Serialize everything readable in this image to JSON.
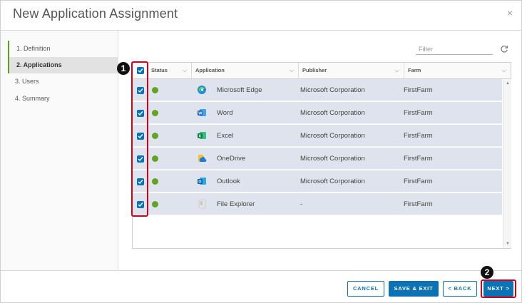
{
  "dialog": {
    "title": "New Application Assignment",
    "close": "×"
  },
  "sidebar": {
    "steps": [
      {
        "label": "1. Definition",
        "state": "done"
      },
      {
        "label": "2. Applications",
        "state": "active"
      },
      {
        "label": "3. Users",
        "state": "pending"
      },
      {
        "label": "4. Summary",
        "state": "pending"
      }
    ]
  },
  "filter": {
    "placeholder": "Filter",
    "value": ""
  },
  "grid": {
    "columns": [
      "Status",
      "Application",
      "Publisher",
      "Farm"
    ],
    "header_checkbox_checked": true,
    "rows": [
      {
        "checked": true,
        "status": "green",
        "icon": "edge-icon",
        "application": "Microsoft Edge",
        "publisher": "Microsoft Corporation",
        "farm": "FirstFarm"
      },
      {
        "checked": true,
        "status": "green",
        "icon": "word-icon",
        "application": "Word",
        "publisher": "Microsoft Corporation",
        "farm": "FirstFarm"
      },
      {
        "checked": true,
        "status": "green",
        "icon": "excel-icon",
        "application": "Excel",
        "publisher": "Microsoft Corporation",
        "farm": "FirstFarm"
      },
      {
        "checked": true,
        "status": "green",
        "icon": "onedrive-icon",
        "application": "OneDrive",
        "publisher": "Microsoft Corporation",
        "farm": "FirstFarm"
      },
      {
        "checked": true,
        "status": "green",
        "icon": "outlook-icon",
        "application": "Outlook",
        "publisher": "Microsoft Corporation",
        "farm": "FirstFarm"
      },
      {
        "checked": true,
        "status": "green",
        "icon": "file-explorer-icon",
        "application": "File Explorer",
        "publisher": "-",
        "farm": "FirstFarm"
      }
    ]
  },
  "callouts": {
    "one": "1",
    "two": "2"
  },
  "footer": {
    "cancel": "CANCEL",
    "save_exit": "SAVE & EXIT",
    "back": "< BACK",
    "next": "NEXT >"
  },
  "colors": {
    "accent": "#0c72b6",
    "status_green": "#62a420",
    "row_selected": "#dfe3ee",
    "callout_red": "#d0021b"
  }
}
